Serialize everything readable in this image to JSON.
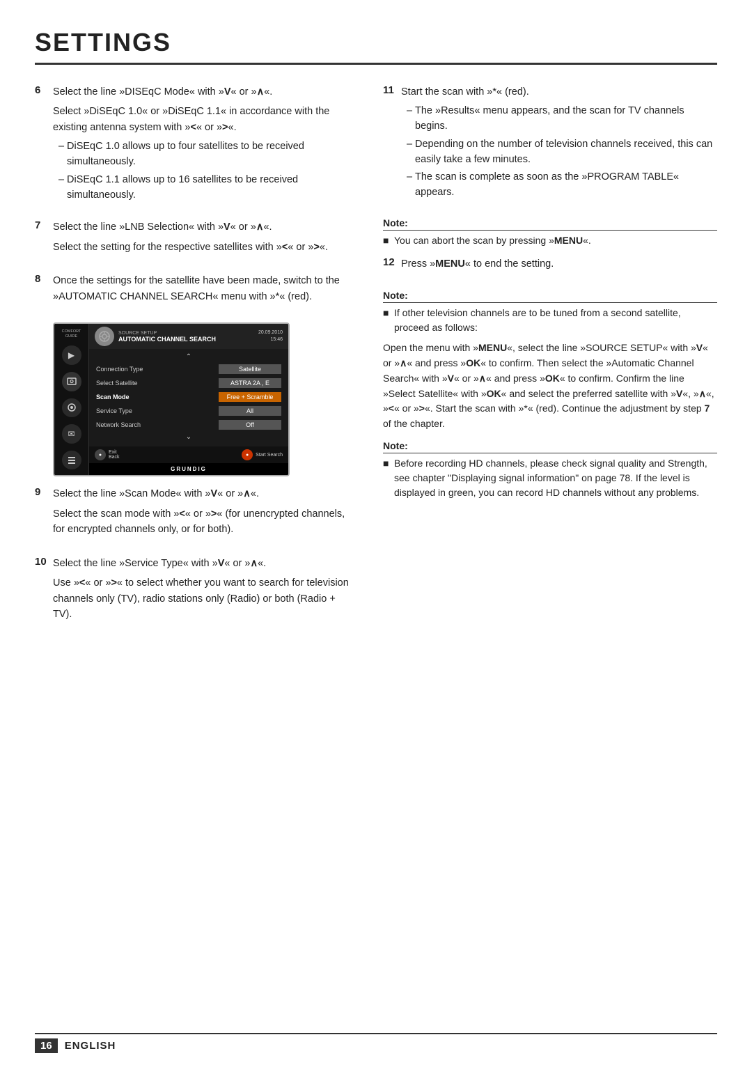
{
  "page": {
    "title": "SETTINGS",
    "footer": {
      "page_num": "16",
      "language": "ENGLISH"
    }
  },
  "steps": {
    "step6": {
      "num": "6",
      "para1": "Select the line »DISEqC Mode« with »V« or »∧«.",
      "para2": "Select »DiSEqC 1.0« or »DiSEqC 1.1« in accordance with the existing antenna system with »<« or »>«.",
      "bullets": [
        "DiSEqC 1.0 allows up to four satellites to be received simultaneously.",
        "DiSEqC 1.1 allows up to 16 satellites to be received simultaneously."
      ]
    },
    "step7": {
      "num": "7",
      "para1": "Select the line »LNB Selection« with »V« or »∧«.",
      "para2": "Select the setting for the respective satellites with »<« or »>«."
    },
    "step8": {
      "num": "8",
      "para1": "Once the settings for the satellite have been made, switch to the »AUTOMATIC CHANNEL SEARCH« menu with »*« (red)."
    },
    "step9": {
      "num": "9",
      "para1": "Select the line »Scan Mode« with »V« or »∧«.",
      "para2": "Select the scan mode with »<« or »>« (for unencrypted channels, for encrypted channels only, or for both)."
    },
    "step10": {
      "num": "10",
      "para1": "Select the line »Service Type« with »V« or »∧«.",
      "para2": "Use »<« or »>« to select whether you want to search for television channels only (TV), radio stations only (Radio) or both (Radio + TV)."
    },
    "step11": {
      "num": "11",
      "para1": "Start the scan with »*« (red).",
      "bullets": [
        "The »Results« menu appears, and the scan for TV channels begins.",
        "Depending on the number of television channels received, this can easily take a few minutes.",
        "The scan is complete as soon as the »PROGRAM TABLE« appears."
      ]
    },
    "step12": {
      "num": "12",
      "para1": "Press »MENU« to end the setting."
    }
  },
  "notes": {
    "note1": {
      "title": "Note:",
      "items": [
        "You can abort the scan by pressing »MENU«."
      ]
    },
    "note2": {
      "title": "Note:",
      "items": [
        "If other television channels are to be tuned from a second satellite, proceed as follows:"
      ]
    },
    "note2_body": "Open the menu with »MENU«, select the line »SOURCE SETUP« with »V« or »∧« and press »OK« to confirm. Then select the »Automatic Channel Search« with »V« or »∧« and press »OK« to confirm. Confirm the line »Select Satellite« with »OK« and select the preferred satellite with »V«, »∧«, »<« or »>«. Start the scan with »*« (red). Continue the adjustment by step 7 of the chapter.",
    "note3": {
      "title": "Note:",
      "items": [
        "Before recording HD channels, please check signal quality and Strength, see chapter \"Displaying signal information\" on page 78. If the level is displayed in green, you can record HD channels without any problems."
      ]
    }
  },
  "device": {
    "source_setup": "SOURCE SETUP",
    "date": "20.09.2010",
    "time": "15:46",
    "title": "AUTOMATIC CHANNEL SEARCH",
    "rows": [
      {
        "label": "Connection Type",
        "value": "Satellite",
        "orange": false
      },
      {
        "label": "Select Satellite",
        "value": "ASTRA 2A , E",
        "orange": false
      },
      {
        "label": "Scan Mode",
        "value": "Free + Scramble",
        "orange": true
      },
      {
        "label": "Service Type",
        "value": "All",
        "orange": false
      },
      {
        "label": "Network Search",
        "value": "Off",
        "orange": false
      }
    ],
    "footer_exit": "Exit\nBack",
    "footer_start": "Start Search",
    "grundig": "GRUNDIG"
  }
}
